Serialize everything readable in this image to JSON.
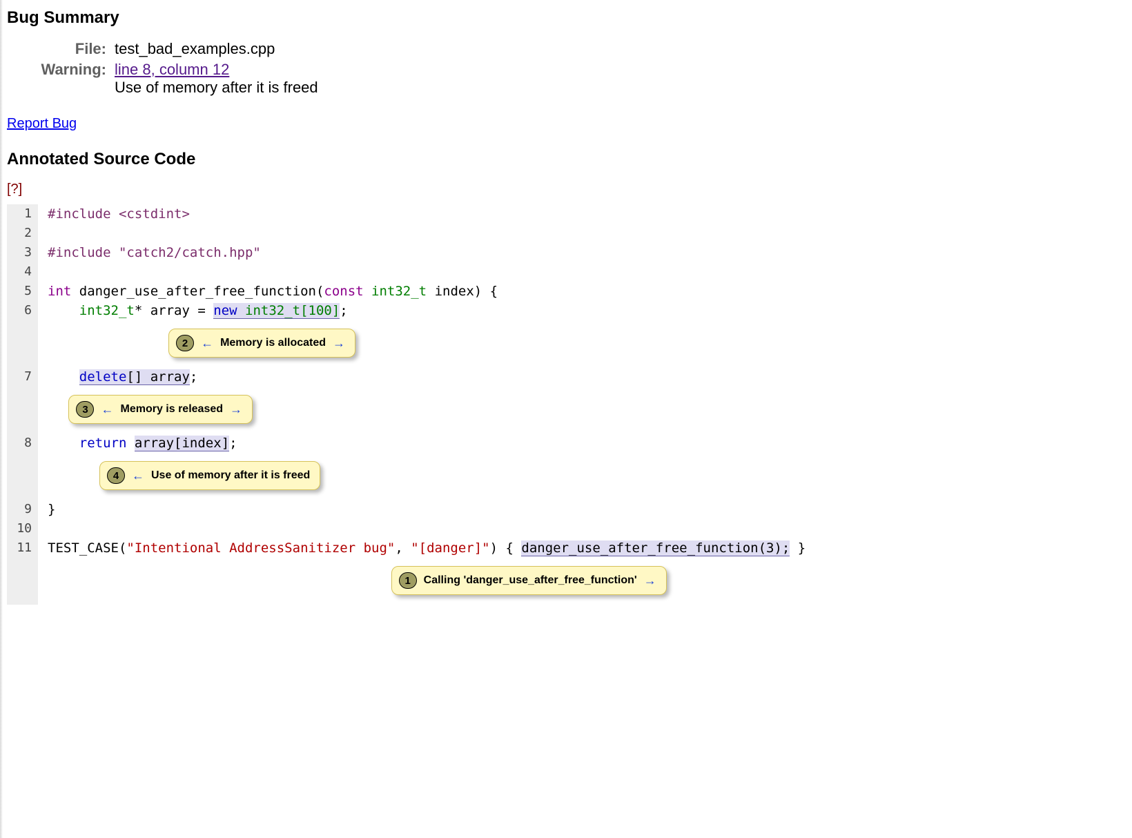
{
  "headings": {
    "summary": "Bug Summary",
    "annotated": "Annotated Source Code"
  },
  "summary": {
    "file_label": "File:",
    "file_value": "test_bad_examples.cpp",
    "warning_label": "Warning:",
    "warning_link": "line 8, column 12",
    "warning_desc": "Use of memory after it is freed"
  },
  "links": {
    "report_bug": "Report Bug",
    "help": "[?]"
  },
  "code": {
    "l1": {
      "num": "1",
      "dir": "#include",
      "inc": "<cstdint>"
    },
    "l2": {
      "num": "2"
    },
    "l3": {
      "num": "3",
      "dir": "#include",
      "inc": "\"catch2/catch.hpp\""
    },
    "l4": {
      "num": "4"
    },
    "l5": {
      "num": "5",
      "kw_int": "int",
      "fn": "danger_use_after_free_function(",
      "kw_const": "const",
      "type": "int32_t",
      "rest": " index) {"
    },
    "l6": {
      "num": "6",
      "indent": "    ",
      "type": "int32_t",
      "star": "* array = ",
      "kw_new": "new",
      "sp": " ",
      "alloc": "int32_t[100]",
      "semi": ";"
    },
    "l7": {
      "num": "7",
      "indent": "    ",
      "del": "delete",
      "arr": "[] array",
      "semi": ";"
    },
    "l8": {
      "num": "8",
      "indent": "    ",
      "ret": "return",
      "sp": " ",
      "expr": "array[index]",
      "semi": ";"
    },
    "l9": {
      "num": "9",
      "brace": "}"
    },
    "l10": {
      "num": "10"
    },
    "l11": {
      "num": "11",
      "macro": "TEST_CASE",
      "paren_open": "(",
      "str1": "\"Intentional AddressSanitizer bug\"",
      "comma": ", ",
      "str2": "\"[danger]\"",
      "paren_close": ")",
      "brace_open": " { ",
      "call": "danger_use_after_free_function(3);",
      "brace_close": " }"
    }
  },
  "msgs": {
    "m2": {
      "step": "2",
      "text": "Memory is allocated",
      "left": "←",
      "right": "→"
    },
    "m3": {
      "step": "3",
      "text": "Memory is released",
      "left": "←",
      "right": "→"
    },
    "m4": {
      "step": "4",
      "text": "Use of memory after it is freed",
      "left": "←"
    },
    "m1": {
      "step": "1",
      "text": "Calling 'danger_use_after_free_function'",
      "right": "→"
    }
  }
}
